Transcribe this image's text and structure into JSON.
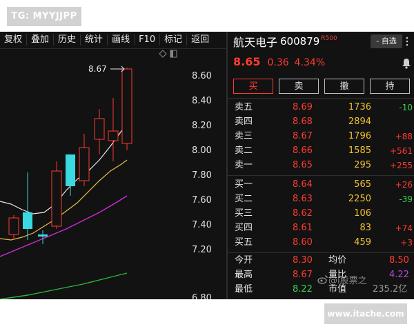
{
  "watermark_top": "TG: MYYJJPP",
  "watermark_bottom": "www.itache.com",
  "toolbar": {
    "items": [
      "复权",
      "叠加",
      "历史",
      "统计",
      "画线",
      "F10",
      "标记",
      "返回"
    ]
  },
  "chart": {
    "axis_labels": [
      "8.60",
      "8.40",
      "8.20",
      "8.00",
      "7.80",
      "7.60",
      "7.40",
      "7.20",
      "6.80"
    ],
    "high_marker": "8.67",
    "colors": {
      "up": "#ff3b30",
      "down": "#3ad8e0",
      "ma5": "#e8e8e8",
      "ma10": "#e5c04a",
      "ma20": "#d12bd6",
      "ma60": "#2bb53a"
    }
  },
  "stock": {
    "name": "航天电子",
    "code": "600879",
    "tag": "R500",
    "watch_label": "- 自选",
    "price": "8.65",
    "change": "0.36",
    "pct": "4.34%"
  },
  "trade_buttons": [
    "买",
    "卖",
    "撤",
    "持"
  ],
  "sell_orders": [
    {
      "label": "卖五",
      "price": "8.69",
      "vol": "1736",
      "chg": "-10",
      "chg_color": "#39d353"
    },
    {
      "label": "卖四",
      "price": "8.68",
      "vol": "2894",
      "chg": "",
      "chg_color": "#39d353"
    },
    {
      "label": "卖三",
      "price": "8.67",
      "vol": "1796",
      "chg": "+88",
      "chg_color": "#ff3b30"
    },
    {
      "label": "卖二",
      "price": "8.66",
      "vol": "1585",
      "chg": "+561",
      "chg_color": "#ff3b30"
    },
    {
      "label": "卖一",
      "price": "8.65",
      "vol": "295",
      "chg": "+255",
      "chg_color": "#ff3b30"
    }
  ],
  "buy_orders": [
    {
      "label": "买一",
      "price": "8.64",
      "vol": "565",
      "chg": "+26",
      "chg_color": "#ff3b30"
    },
    {
      "label": "买二",
      "price": "8.63",
      "vol": "2250",
      "chg": "-39",
      "chg_color": "#39d353"
    },
    {
      "label": "买三",
      "price": "8.62",
      "vol": "106",
      "chg": "",
      "chg_color": "#39d353"
    },
    {
      "label": "买四",
      "price": "8.61",
      "vol": "83",
      "chg": "+74",
      "chg_color": "#ff3b30"
    },
    {
      "label": "买五",
      "price": "8.60",
      "vol": "459",
      "chg": "+3",
      "chg_color": "#ff3b30"
    }
  ],
  "stats": {
    "open_label": "今开",
    "open": "8.30",
    "avg_label": "均价",
    "avg": "8.50",
    "high_label": "最高",
    "high": "8.67",
    "ratio_label": "量比",
    "ratio": "4.22",
    "low_label": "最低",
    "low": "8.22",
    "mcap_label": "市值",
    "mcap": "235.2亿"
  },
  "weibo_watermark": "@i股票之"
}
